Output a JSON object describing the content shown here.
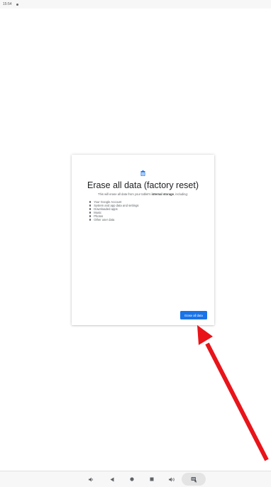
{
  "status_bar": {
    "time": "15:54"
  },
  "dialog": {
    "icon": "trash-icon",
    "title": "Erase all data (factory reset)",
    "description_prefix": "This will erase all data from your tablet's ",
    "description_bold": "internal storage",
    "description_suffix": ", including:",
    "items": [
      "Your Google Account",
      "System and app data and settings",
      "Downloaded apps",
      "Music",
      "Photos",
      "Other user data"
    ],
    "erase_button_label": "Erase all data",
    "accent_color": "#1a73e8"
  },
  "nav_bar": {
    "buttons": [
      "volume-down-icon",
      "back-icon",
      "home-icon",
      "recents-icon",
      "volume-up-icon",
      "screenshot-icon"
    ]
  },
  "annotation": {
    "arrow_color": "#e8141a"
  }
}
